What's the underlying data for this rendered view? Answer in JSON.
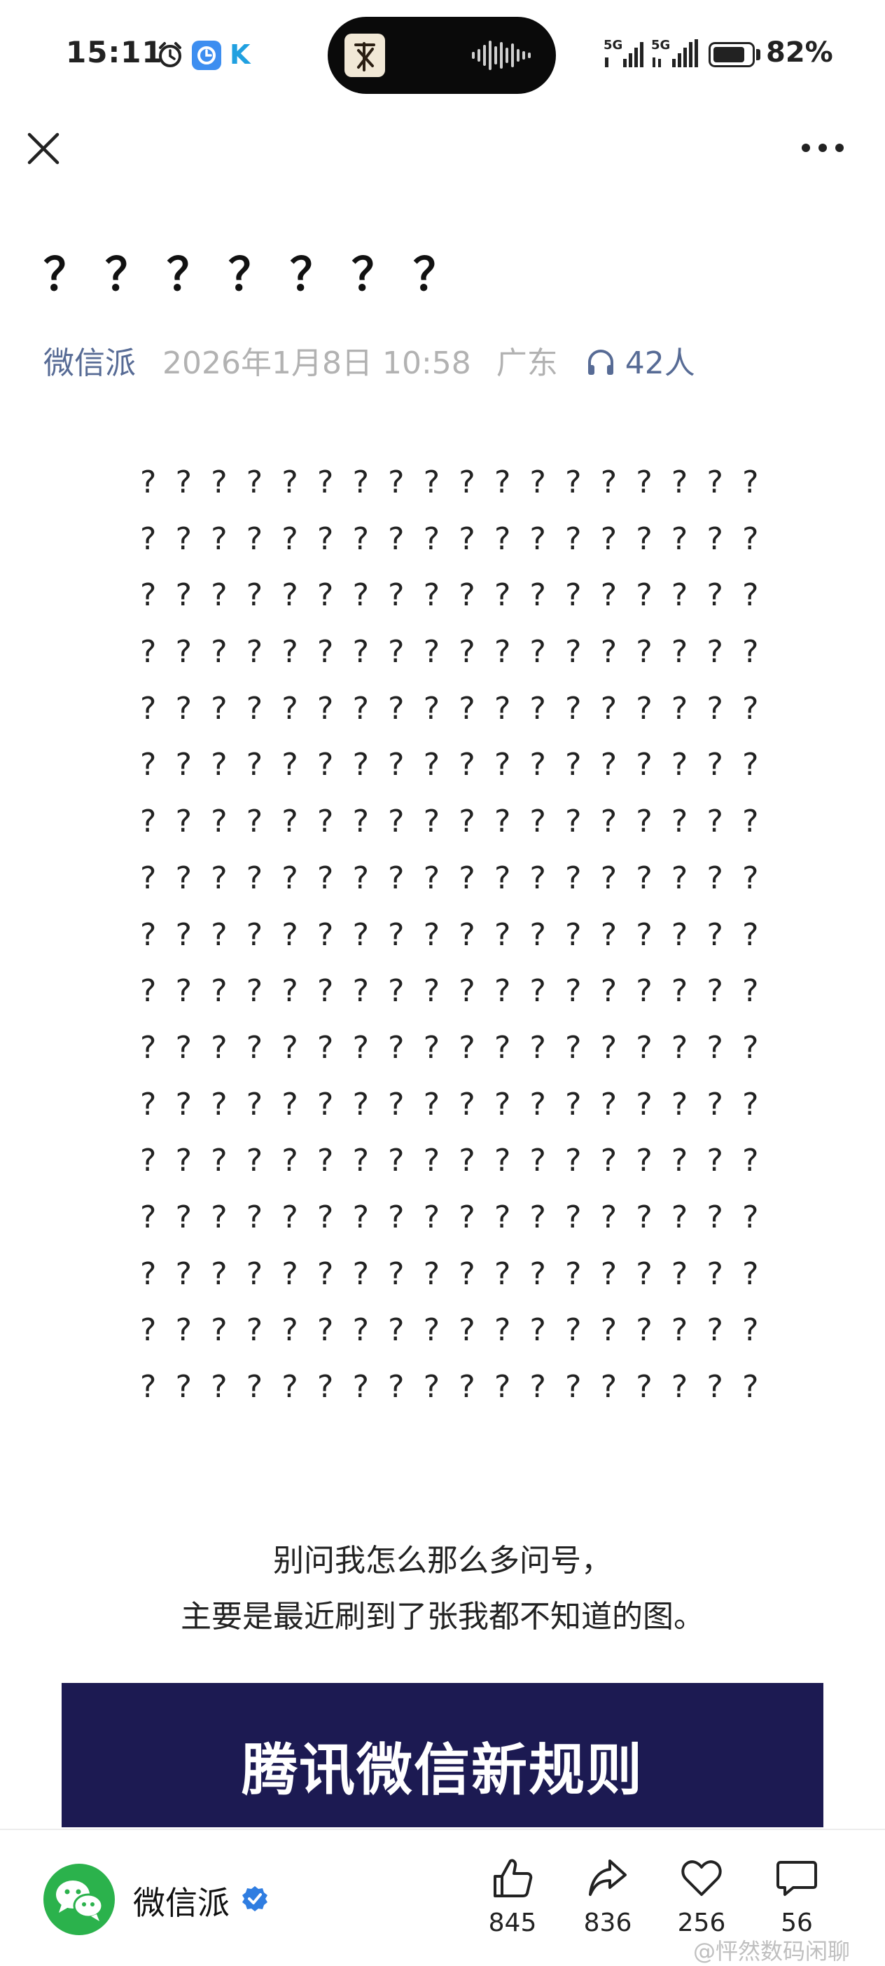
{
  "status_bar": {
    "time": "15:11",
    "signal_1": "5G",
    "signal_2": "5G",
    "battery_percent": "82%",
    "battery_level": 0.82,
    "icons": [
      "alarm-icon",
      "app-icon-blue",
      "app-icon-k"
    ]
  },
  "nav": {
    "close_icon": "close-icon",
    "more_icon": "more-icon"
  },
  "article": {
    "title": "？？？？？？？",
    "author": "微信派",
    "date": "2026年1月8日 10:58",
    "region": "广东",
    "listeners": "42人",
    "question_rows": [
      "? ? ? ? ? ? ? ? ? ? ? ? ? ? ? ? ? ?",
      "? ? ? ? ? ? ? ? ? ? ? ? ? ? ? ? ? ?",
      "? ? ? ? ? ? ? ? ? ? ? ? ? ? ? ? ? ?",
      "? ? ? ? ? ? ? ? ? ? ? ? ? ? ? ? ? ?",
      "? ? ? ? ? ? ? ? ? ? ? ? ? ? ? ? ? ?",
      "? ? ? ? ? ? ? ? ? ? ? ? ? ? ? ? ? ?",
      "? ? ? ? ? ? ? ? ? ? ? ? ? ? ? ? ? ?",
      "? ? ? ? ? ? ? ? ? ? ? ? ? ? ? ? ? ?",
      "? ? ? ? ? ? ? ? ? ? ? ? ? ? ? ? ? ?",
      "? ? ? ? ? ? ? ? ? ? ? ? ? ? ? ? ? ?",
      "? ? ? ? ? ? ? ? ? ? ? ? ? ? ? ? ? ?",
      "? ? ? ? ? ? ? ? ? ? ? ? ? ? ? ? ? ?",
      "? ? ? ? ? ? ? ? ? ? ? ? ? ? ? ? ? ?",
      "? ? ? ? ? ? ? ? ? ? ? ? ? ? ? ? ? ?",
      "? ? ? ? ? ? ? ? ? ? ? ? ? ? ? ? ? ?",
      "? ? ? ? ? ? ? ? ? ? ? ? ? ? ? ? ? ?",
      "? ? ? ? ? ? ? ? ? ? ? ? ? ? ? ? ? ?"
    ],
    "caption_line1": "别问我怎么那么多问号，",
    "caption_line2": "主要是最近刷到了张我都不知道的图。",
    "banner_text": "腾讯微信新规则",
    "banner_color": "#1c1a52"
  },
  "bottom_bar": {
    "account_name": "微信派",
    "like_count": "845",
    "share_count": "836",
    "favorite_count": "256",
    "comment_count": "56"
  },
  "watermark": "@怦然数码闲聊",
  "colors": {
    "link": "#576b95",
    "meta_gray": "#b2b2b2",
    "wechat_green": "#2bb24c",
    "verified_blue": "#2f7de1"
  }
}
